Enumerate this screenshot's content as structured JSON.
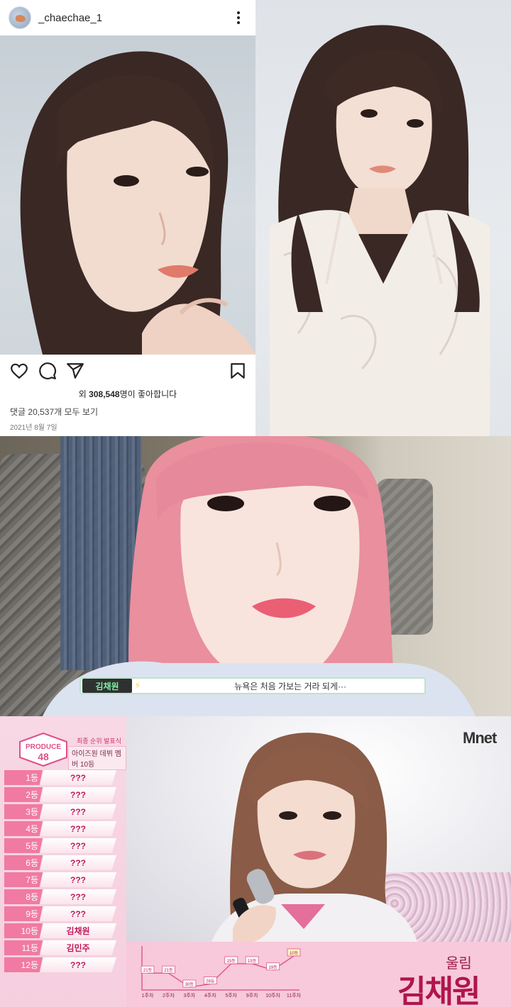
{
  "instagram": {
    "username": "_chaechae_1",
    "likes_prefix": "외 ",
    "likes_count": "308,548",
    "likes_suffix": "명이 좋아합니다",
    "comments_link": "댓글 20,537개 모두 보기",
    "date": "2021년 8월 7일",
    "icons": [
      "heart-icon",
      "comment-icon",
      "share-icon",
      "bookmark-icon",
      "more-options-icon"
    ]
  },
  "video_subtitle": {
    "name_tag": "김채원",
    "bolt": "⚡",
    "text": "뉴욕은 처음 가보는 거라 되게···"
  },
  "produce48": {
    "logo_lines": [
      "PRODUCE",
      "48"
    ],
    "title_1": "최종 순위 발표식",
    "title_2": "아이즈원 데뷔 멤버 10등",
    "ranks": [
      {
        "num": "1등",
        "name": "???"
      },
      {
        "num": "2등",
        "name": "???"
      },
      {
        "num": "3등",
        "name": "???"
      },
      {
        "num": "4등",
        "name": "???"
      },
      {
        "num": "5등",
        "name": "???"
      },
      {
        "num": "6등",
        "name": "???"
      },
      {
        "num": "7등",
        "name": "???"
      },
      {
        "num": "8등",
        "name": "???"
      },
      {
        "num": "9등",
        "name": "???"
      },
      {
        "num": "10등",
        "name": "김채원"
      },
      {
        "num": "11등",
        "name": "김민주"
      },
      {
        "num": "12등",
        "name": "???"
      }
    ],
    "broadcaster": "Mnet",
    "caption_small": "울림",
    "caption_big": "김채원",
    "graph": {
      "weeks": [
        "1주차",
        "2주차",
        "3주차",
        "4주차",
        "5주차",
        "9주차",
        "10주차",
        "11주차"
      ],
      "ranks": [
        "21등",
        "21등",
        "30등",
        "28등",
        "15등",
        "15등",
        "19등",
        "10등"
      ]
    }
  }
}
